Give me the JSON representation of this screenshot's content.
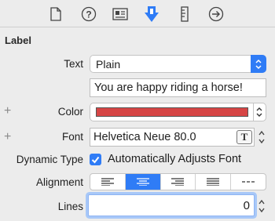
{
  "toolbar": {
    "tabs": [
      {
        "icon": "file-icon",
        "active": false
      },
      {
        "icon": "help-icon",
        "active": false
      },
      {
        "icon": "identity-icon",
        "active": false
      },
      {
        "icon": "attributes-icon",
        "active": true
      },
      {
        "icon": "ruler-icon",
        "active": false
      },
      {
        "icon": "connections-icon",
        "active": false
      }
    ]
  },
  "section": {
    "title": "Label"
  },
  "text": {
    "label": "Text",
    "type_value": "Plain",
    "content": "You are happy riding a horse!"
  },
  "color": {
    "label": "Color",
    "plus": "+",
    "swatch_hex": "#d64545"
  },
  "font": {
    "label": "Font",
    "plus": "+",
    "value": "Helvetica Neue 80.0",
    "button": "T"
  },
  "dynamic_type": {
    "label": "Dynamic Type",
    "checkbox_label": "Automatically Adjusts Font",
    "checked": true
  },
  "alignment": {
    "label": "Alignment",
    "options": [
      "left",
      "center",
      "right",
      "justified",
      "natural"
    ],
    "selected": "center"
  },
  "lines": {
    "label": "Lines",
    "value": "0"
  },
  "colors": {
    "accent": "#2f7cf6",
    "background": "#ececec"
  }
}
